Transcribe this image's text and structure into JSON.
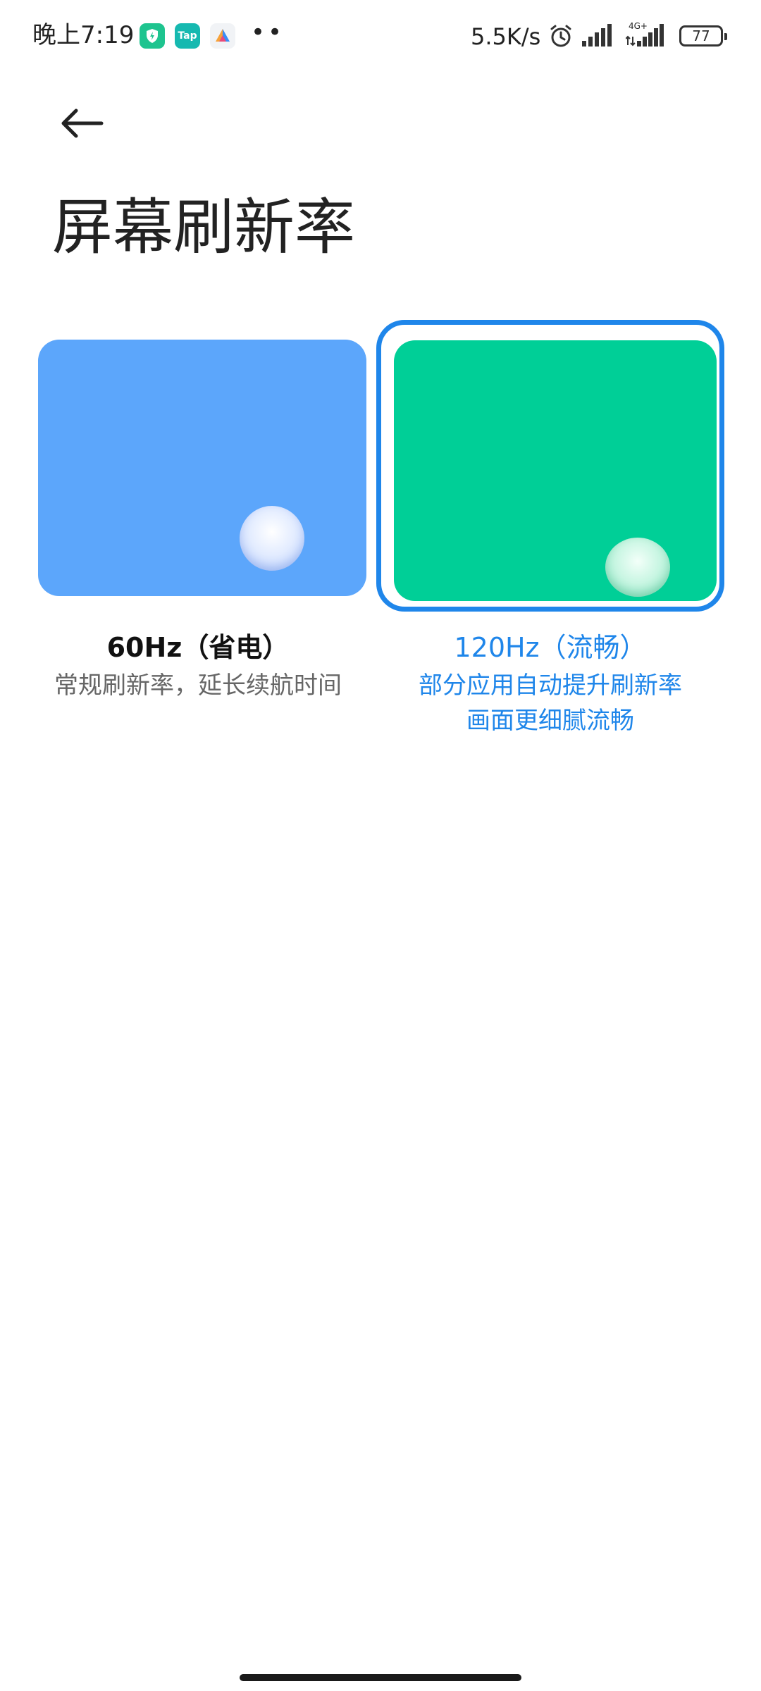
{
  "status_bar": {
    "time": "晚上7:19",
    "app_icons": [
      "shield-bolt-icon",
      "taptap-icon",
      "triangle-app-icon"
    ],
    "app2_label": "Tap",
    "more": "••",
    "net_speed": "5.5K/s",
    "net_type": "4G+",
    "battery": "77"
  },
  "header": {
    "title": "屏幕刷新率"
  },
  "options": [
    {
      "label": "60Hz（省电）",
      "description_lines": [
        "常规刷新率，延长续航时间"
      ],
      "preview_color": "#5ca6fb",
      "selected": false
    },
    {
      "label": "120Hz（流畅）",
      "description_lines": [
        "部分应用自动提升刷新率",
        "画面更细腻流畅"
      ],
      "preview_color": "#00cf97",
      "selected": true
    }
  ],
  "colors": {
    "accent": "#1f86ea",
    "blue_preview": "#5ca6fb",
    "green_preview": "#00cf97"
  }
}
